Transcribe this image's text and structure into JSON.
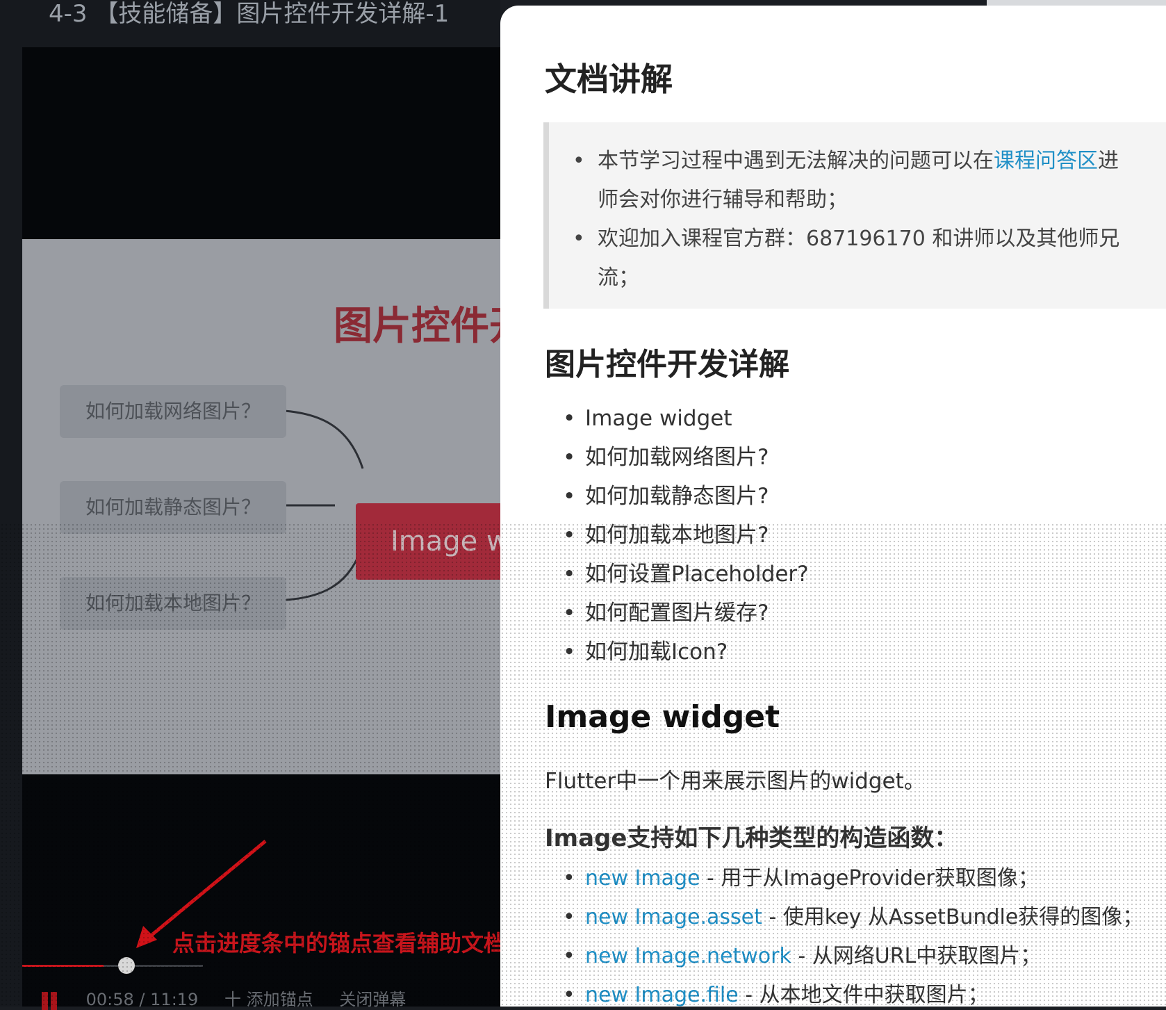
{
  "video": {
    "title": "4-3 【技能储备】图片控件开发详解-1",
    "slide": {
      "heading": "图片控件开",
      "questions": [
        "如何加载网络图片？",
        "如何加载静态图片？",
        "如何加载本地图片？"
      ],
      "center_node": "Image w"
    },
    "hint": "点击进度条中的锚点查看辅助文档",
    "progress": 0.45,
    "controls": {
      "time": "00:58 / 11:19",
      "add_anchor": "十 添加锚点",
      "close_danmaku": "关闭弹幕"
    }
  },
  "doc": {
    "title": "文档讲解",
    "notice": {
      "item1_pre": "本节学习过程中遇到无法解决的问题可以在",
      "item1_link": "课程问答区",
      "item1_post": "进",
      "item1_line2": "师会对你进行辅导和帮助；",
      "item2_line1": "欢迎加入课程官方群：687196170 和讲师以及其他师兄",
      "item2_line2": "流；"
    },
    "section_title": "图片控件开发详解",
    "toc": [
      "Image widget",
      "如何加载网络图片?",
      "如何加载静态图片?",
      "如何加载本地图片?",
      "如何设置Placeholder?",
      "如何配置图片缓存?",
      "如何加载Icon?"
    ],
    "subsection_title": "Image widget",
    "description": "Flutter中一个用来展示图片的widget。",
    "ctor_heading": "Image支持如下几种类型的构造函数：",
    "constructors": [
      {
        "link": "new Image",
        "text": " - 用于从ImageProvider获取图像；"
      },
      {
        "link": "new Image.asset",
        "text": " - 使用key 从AssetBundle获得的图像；"
      },
      {
        "link": "new Image.network",
        "text": " - 从网络URL中获取图片；"
      },
      {
        "link": "new Image.file",
        "text": " - 从本地文件中获取图片；"
      }
    ]
  },
  "colors": {
    "accent_red": "#c8151c",
    "link_blue": "#1f8fc6",
    "slide_node": "#a22a3a"
  }
}
